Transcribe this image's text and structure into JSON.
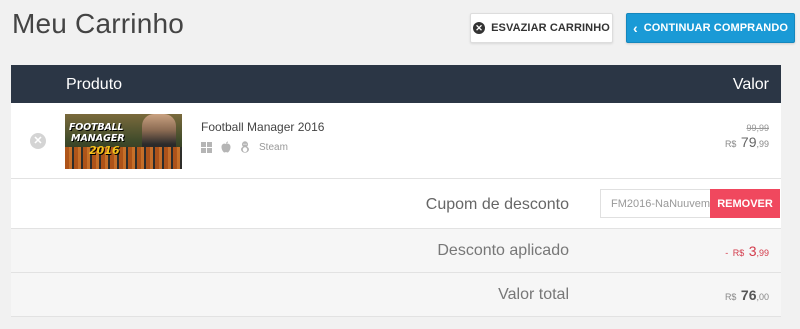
{
  "page": {
    "title": "Meu Carrinho"
  },
  "actions": {
    "empty_label": "ESVAZIAR CARRINHO",
    "continue_label": "CONTINUAR COMPRANDO"
  },
  "table": {
    "header_product": "Produto",
    "header_value": "Valor"
  },
  "item": {
    "name": "Football Manager 2016",
    "thumb_line1": "FOOTBALL",
    "thumb_line2": "MANAGER",
    "thumb_year": "2016",
    "platforms": [
      "windows-icon",
      "apple-icon",
      "linux-icon"
    ],
    "store": "Steam",
    "old_price": "99,99",
    "currency": "R$",
    "price_int": "79",
    "price_dec": ",99"
  },
  "coupon": {
    "label": "Cupom de desconto",
    "value": "FM2016-NaNuuvem",
    "button": "REMOVER"
  },
  "discount": {
    "label": "Desconto aplicado",
    "sign": "-",
    "currency": "R$",
    "int": "3",
    "dec": ",99"
  },
  "total": {
    "label": "Valor total",
    "currency": "R$",
    "int": "76",
    "dec": ",00"
  },
  "colors": {
    "header_bg": "#2b3645",
    "continue_bg": "#1a9ad6",
    "remove_bg": "#f0485e",
    "discount_text": "#d33a4a"
  }
}
